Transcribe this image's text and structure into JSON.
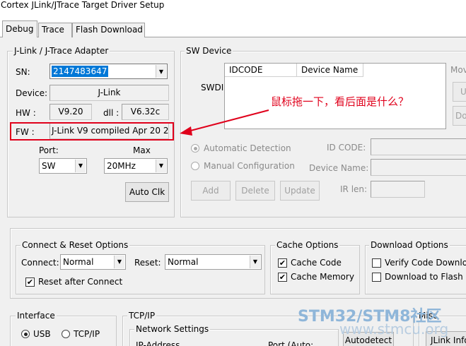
{
  "window": {
    "title": "Cortex JLink/JTrace Target Driver Setup"
  },
  "tabs": [
    {
      "label": "Debug",
      "active": true
    },
    {
      "label": "Trace",
      "active": false
    },
    {
      "label": "Flash Download",
      "active": false
    }
  ],
  "adapter": {
    "title": "J-Link / J-Trace Adapter",
    "sn_label": "SN:",
    "sn_value": "2147483647",
    "device_label": "Device:",
    "device_value": "J-Link",
    "hw_label": "HW :",
    "hw_value": "V9.20",
    "dll_label": "dll :",
    "dll_value": "V6.32c",
    "fw_label": "FW :",
    "fw_value": "J-Link V9 compiled Apr 20 2",
    "port_label": "Port:",
    "port_value": "SW",
    "max_label": "Max",
    "max_value": "20MHz",
    "auto_clk": "Auto Clk"
  },
  "sw_device": {
    "title": "SW Device",
    "swdi_label": "SWDI",
    "columns": [
      "IDCODE",
      "Device Name"
    ],
    "move_label": "Mov",
    "up_label": "U",
    "down_label": "Do",
    "auto_detection": "Automatic Detection",
    "manual_config": "Manual Configuration",
    "id_code_label": "ID CODE:",
    "device_name_label": "Device Name:",
    "ir_len_label": "IR len:",
    "add": "Add",
    "delete": "Delete",
    "update": "Update"
  },
  "annotation": {
    "text": "鼠标拖一下，看后面是什么？",
    "color": "#e0001b"
  },
  "connect_reset": {
    "title": "Connect & Reset Options",
    "connect_label": "Connect:",
    "connect_value": "Normal",
    "reset_label": "Reset:",
    "reset_value": "Normal",
    "reset_after_connect": "Reset after Connect"
  },
  "cache": {
    "title": "Cache Options",
    "cache_code": "Cache Code",
    "cache_memory": "Cache Memory"
  },
  "download": {
    "title": "Download Options",
    "verify": "Verify Code Downlo",
    "to_flash": "Download to Flash"
  },
  "interface": {
    "title": "Interface",
    "usb": "USB",
    "tcpip": "TCP/IP"
  },
  "tcpip": {
    "title": "TCP/IP",
    "network_settings": "Network Settings",
    "ip_address": "IP-Address",
    "port_auto": "Port (Auto:",
    "autodetect": "Autodetect"
  },
  "misc": {
    "title": "Misc",
    "jlink_info": "JLink Info"
  },
  "watermark": {
    "line1": "STM32/STM8社区",
    "line2": "www.stmcu.org"
  }
}
